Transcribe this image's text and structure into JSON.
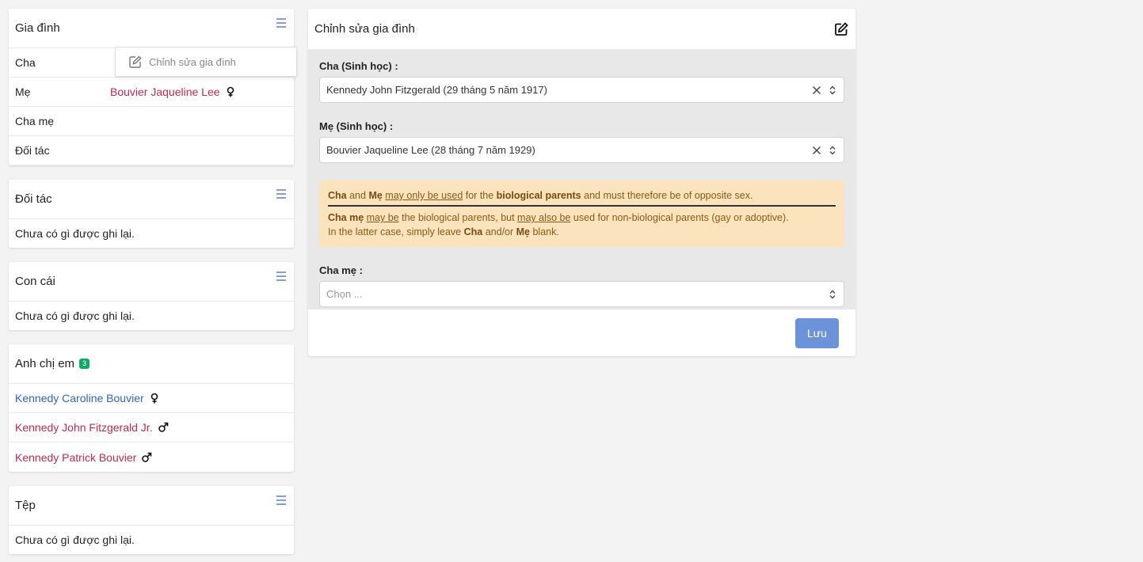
{
  "family_card": {
    "title": "Gia đình",
    "rows": [
      {
        "label": "Cha",
        "value": ""
      },
      {
        "label": "Mẹ",
        "value": "Bouvier Jaqueline Lee"
      },
      {
        "label": "Cha mẹ",
        "value": ""
      },
      {
        "label": "Đối tác",
        "value": ""
      }
    ],
    "dropdown_item": "Chỉnh sửa gia đình"
  },
  "partners_card": {
    "title": "Đối tác",
    "empty": "Chưa có gì được ghi lại."
  },
  "children_card": {
    "title": "Con cái",
    "empty": "Chưa có gì được ghi lại."
  },
  "siblings_card": {
    "title": "Anh chị em",
    "count": "3",
    "items": [
      {
        "name": "Kennedy Caroline Bouvier",
        "sex": "female"
      },
      {
        "name": "Kennedy John Fitzgerald Jr.",
        "sex": "male"
      },
      {
        "name": "Kennedy Patrick Bouvier",
        "sex": "male"
      }
    ]
  },
  "files_card": {
    "title": "Tệp",
    "empty": "Chưa có gì được ghi lại."
  },
  "edit_panel": {
    "title": "Chỉnh sửa gia đình",
    "father_label": "Cha (Sinh học) :",
    "father_value": "Kennedy John Fitzgerald (29 tháng 5 năm 1917)",
    "mother_label": "Mẹ (Sinh học) :",
    "mother_value": "Bouvier Jaqueline Lee (28 tháng 7 năm 1929)",
    "notice": {
      "l1_cha": "Cha",
      "l1_and": " and ",
      "l1_me": "Mẹ",
      "l1_sp": " ",
      "l1_may_only": "may only be used",
      "l1_for": " for the ",
      "l1_bio": "biological parents",
      "l1_rest": " and must therefore be of opposite sex.",
      "l2_chame": "Cha mẹ",
      "l2_sp": " ",
      "l2_maybe": "may be",
      "l2_mid": " the biological parents, but ",
      "l2_mayalso": "may also be",
      "l2_rest": " used for non-biological parents (gay or adoptive).",
      "l3_start": "In the latter case, simply leave ",
      "l3_cha": "Cha",
      "l3_mid": " and/or ",
      "l3_me": "Mẹ",
      "l3_end": " blank."
    },
    "parents_label": "Cha mẹ :",
    "parents_placeholder": "Chọn ...",
    "save_label": "Lưu"
  }
}
